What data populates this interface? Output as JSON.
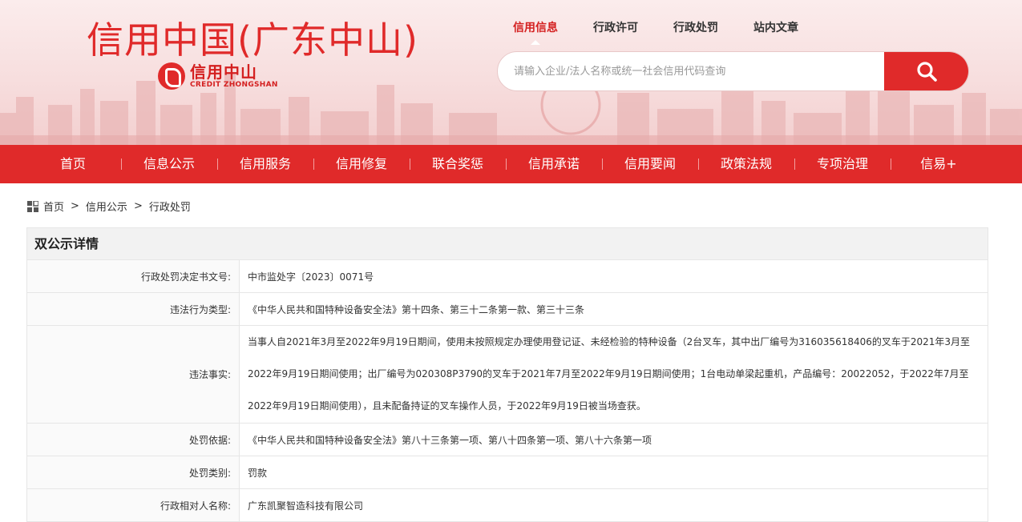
{
  "header": {
    "site_title": "信用中国(广东中山)",
    "logo_cn": "信用中山",
    "logo_en": "CREDIT ZHONGSHAN",
    "top_tabs": [
      {
        "label": "信用信息",
        "active": true
      },
      {
        "label": "行政许可",
        "active": false
      },
      {
        "label": "行政处罚",
        "active": false
      },
      {
        "label": "站内文章",
        "active": false
      }
    ],
    "search_placeholder": "请输入企业/法人名称或统一社会信用代码查询",
    "accent_color": "#e02a2a"
  },
  "nav": {
    "items": [
      "首页",
      "信息公示",
      "信用服务",
      "信用修复",
      "联合奖惩",
      "信用承诺",
      "信用要闻",
      "政策法规",
      "专项治理",
      "信易+"
    ]
  },
  "breadcrumb": {
    "items": [
      "首页",
      "信用公示",
      "行政处罚"
    ],
    "separator": ">"
  },
  "panel": {
    "title": "双公示详情",
    "rows": [
      {
        "label": "行政处罚决定书文号:",
        "value": "中市监处字〔2023〕0071号"
      },
      {
        "label": "违法行为类型:",
        "value": "《中华人民共和国特种设备安全法》第十四条、第三十二条第一款、第三十三条"
      },
      {
        "label": "违法事实:",
        "value": "当事人自2021年3月至2022年9月19日期间，使用未按照规定办理使用登记证、未经检验的特种设备（2台叉车，其中出厂编号为316035618406的叉车于2021年3月至2022年9月19日期间使用；出厂编号为020308P3790的叉车于2021年7月至2022年9月19日期间使用；1台电动单梁起重机，产品编号：20022052，于2022年7月至2022年9月19日期间使用），且未配备持证的叉车操作人员，于2022年9月19日被当场查获。"
      },
      {
        "label": "处罚依据:",
        "value": "《中华人民共和国特种设备安全法》第八十三条第一项、第八十四条第一项、第八十六条第一项"
      },
      {
        "label": "处罚类别:",
        "value": "罚款"
      },
      {
        "label": "行政相对人名称:",
        "value": "广东凯聚智造科技有限公司"
      }
    ]
  }
}
